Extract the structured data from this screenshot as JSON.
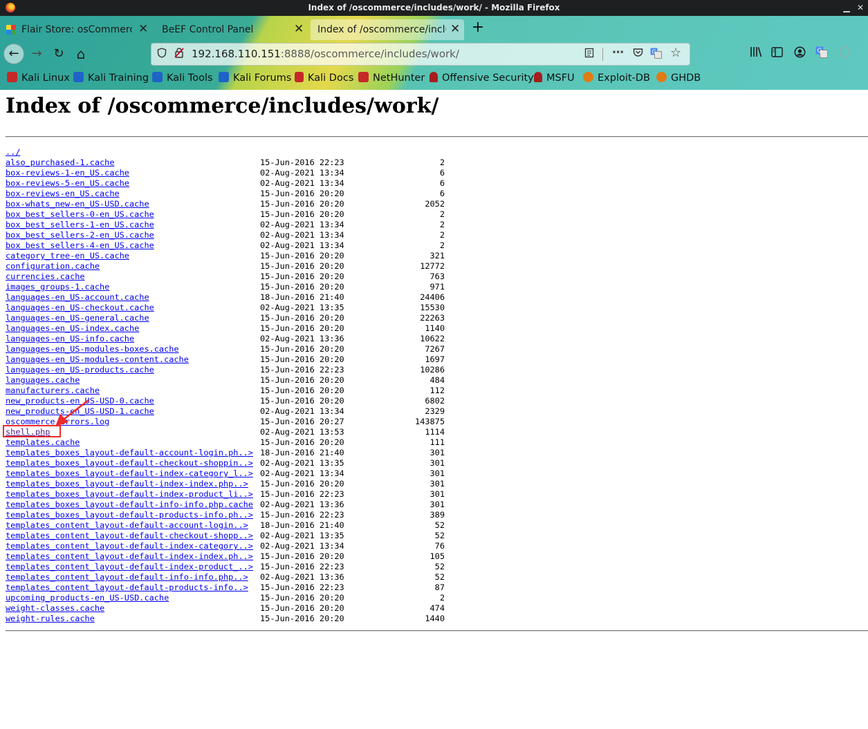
{
  "window": {
    "title": "Index of /oscommerce/includes/work/ - Mozilla Firefox",
    "minimize": "▁",
    "maximize": "☐",
    "close": "✕"
  },
  "tabs": [
    {
      "label": "Flair Store: osCommerce",
      "close": "✕"
    },
    {
      "label": "BeEF Control Panel",
      "close": "✕"
    },
    {
      "label": "Index of /oscommerce/includes/work/",
      "close": "✕"
    }
  ],
  "new_tab": "+",
  "nav": {
    "back": "←",
    "forward": "→",
    "reload": "↻",
    "home": "⌂"
  },
  "url": {
    "host": "192.168.110.151",
    "rest": ":8888/oscommerce/includes/work/"
  },
  "url_icons": [
    "shield-icon",
    "insecure-lock-icon",
    "reader-view-icon",
    "more-actions-icon",
    "pocket-icon",
    "translate-icon",
    "bookmark-star-icon"
  ],
  "toolbar_icons": [
    "library-icon",
    "sidebar-icon",
    "account-icon",
    "translate-icon",
    "extension-icon"
  ],
  "bookmarks": [
    {
      "label": "Kali Linux",
      "color": "#c62828"
    },
    {
      "label": "Kali Training",
      "color": "#1e63c7"
    },
    {
      "label": "Kali Tools",
      "color": "#1e63c7"
    },
    {
      "label": "Kali Forums",
      "color": "#1e63c7"
    },
    {
      "label": "Kali Docs",
      "color": "#c62828"
    },
    {
      "label": "NetHunter",
      "color": "#c62828"
    },
    {
      "label": "Offensive Security",
      "color": "#a51d1d"
    },
    {
      "label": "MSFU",
      "color": "#a51d1d"
    },
    {
      "label": "Exploit-DB",
      "color": "#e07b16"
    },
    {
      "label": "GHDB",
      "color": "#e07b16"
    }
  ],
  "page": {
    "title": "Index of /oscommerce/includes/work/",
    "parent_link": "../",
    "files": [
      {
        "name": "also_purchased-1.cache",
        "date": "15-Jun-2016 22:23",
        "size": "2"
      },
      {
        "name": "box-reviews-1-en_US.cache",
        "date": "02-Aug-2021 13:34",
        "size": "6"
      },
      {
        "name": "box-reviews-5-en_US.cache",
        "date": "02-Aug-2021 13:34",
        "size": "6"
      },
      {
        "name": "box-reviews-en_US.cache",
        "date": "15-Jun-2016 20:20",
        "size": "6"
      },
      {
        "name": "box-whats_new-en_US-USD.cache",
        "date": "15-Jun-2016 20:20",
        "size": "2052"
      },
      {
        "name": "box_best_sellers-0-en_US.cache",
        "date": "15-Jun-2016 20:20",
        "size": "2"
      },
      {
        "name": "box_best_sellers-1-en_US.cache",
        "date": "02-Aug-2021 13:34",
        "size": "2"
      },
      {
        "name": "box_best_sellers-2-en_US.cache",
        "date": "02-Aug-2021 13:34",
        "size": "2"
      },
      {
        "name": "box_best_sellers-4-en_US.cache",
        "date": "02-Aug-2021 13:34",
        "size": "2"
      },
      {
        "name": "category_tree-en_US.cache",
        "date": "15-Jun-2016 20:20",
        "size": "321"
      },
      {
        "name": "configuration.cache",
        "date": "15-Jun-2016 20:20",
        "size": "12772"
      },
      {
        "name": "currencies.cache",
        "date": "15-Jun-2016 20:20",
        "size": "763"
      },
      {
        "name": "images_groups-1.cache",
        "date": "15-Jun-2016 20:20",
        "size": "971"
      },
      {
        "name": "languages-en_US-account.cache",
        "date": "18-Jun-2016 21:40",
        "size": "24406"
      },
      {
        "name": "languages-en_US-checkout.cache",
        "date": "02-Aug-2021 13:35",
        "size": "15530"
      },
      {
        "name": "languages-en_US-general.cache",
        "date": "15-Jun-2016 20:20",
        "size": "22263"
      },
      {
        "name": "languages-en_US-index.cache",
        "date": "15-Jun-2016 20:20",
        "size": "1140"
      },
      {
        "name": "languages-en_US-info.cache",
        "date": "02-Aug-2021 13:36",
        "size": "10622"
      },
      {
        "name": "languages-en_US-modules-boxes.cache",
        "date": "15-Jun-2016 20:20",
        "size": "7267"
      },
      {
        "name": "languages-en_US-modules-content.cache",
        "date": "15-Jun-2016 20:20",
        "size": "1697"
      },
      {
        "name": "languages-en_US-products.cache",
        "date": "15-Jun-2016 22:23",
        "size": "10286"
      },
      {
        "name": "languages.cache",
        "date": "15-Jun-2016 20:20",
        "size": "484"
      },
      {
        "name": "manufacturers.cache",
        "date": "15-Jun-2016 20:20",
        "size": "112"
      },
      {
        "name": "new_products-en_US-USD-0.cache",
        "date": "15-Jun-2016 20:20",
        "size": "6802"
      },
      {
        "name": "new_products-en_US-USD-1.cache",
        "date": "02-Aug-2021 13:34",
        "size": "2329"
      },
      {
        "name": "oscommerce_errors.log",
        "date": "15-Jun-2016 20:27",
        "size": "143875"
      },
      {
        "name": "shell.php",
        "date": "02-Aug-2021 13:53",
        "size": "1114",
        "visited": true
      },
      {
        "name": "templates.cache",
        "date": "15-Jun-2016 20:20",
        "size": "111"
      },
      {
        "name": "templates_boxes_layout-default-account-login.ph..>",
        "date": "18-Jun-2016 21:40",
        "size": "301"
      },
      {
        "name": "templates_boxes_layout-default-checkout-shoppin..>",
        "date": "02-Aug-2021 13:35",
        "size": "301"
      },
      {
        "name": "templates_boxes_layout-default-index-category_l..>",
        "date": "02-Aug-2021 13:34",
        "size": "301"
      },
      {
        "name": "templates_boxes_layout-default-index-index.php..>",
        "date": "15-Jun-2016 20:20",
        "size": "301"
      },
      {
        "name": "templates_boxes_layout-default-index-product_li..>",
        "date": "15-Jun-2016 22:23",
        "size": "301"
      },
      {
        "name": "templates_boxes_layout-default-info-info.php.cache",
        "date": "02-Aug-2021 13:36",
        "size": "301"
      },
      {
        "name": "templates_boxes_layout-default-products-info.ph..>",
        "date": "15-Jun-2016 22:23",
        "size": "389"
      },
      {
        "name": "templates_content_layout-default-account-login..>",
        "date": "18-Jun-2016 21:40",
        "size": "52"
      },
      {
        "name": "templates_content_layout-default-checkout-shopp..>",
        "date": "02-Aug-2021 13:35",
        "size": "52"
      },
      {
        "name": "templates_content_layout-default-index-category..>",
        "date": "02-Aug-2021 13:34",
        "size": "76"
      },
      {
        "name": "templates_content_layout-default-index-index.ph..>",
        "date": "15-Jun-2016 20:20",
        "size": "105"
      },
      {
        "name": "templates_content_layout-default-index-product_..>",
        "date": "15-Jun-2016 22:23",
        "size": "52"
      },
      {
        "name": "templates_content_layout-default-info-info.php..>",
        "date": "02-Aug-2021 13:36",
        "size": "52"
      },
      {
        "name": "templates_content_layout-default-products-info..>",
        "date": "15-Jun-2016 22:23",
        "size": "87"
      },
      {
        "name": "upcoming_products-en_US-USD.cache",
        "date": "15-Jun-2016 20:20",
        "size": "2"
      },
      {
        "name": "weight-classes.cache",
        "date": "15-Jun-2016 20:20",
        "size": "474"
      },
      {
        "name": "weight-rules.cache",
        "date": "15-Jun-2016 20:20",
        "size": "1440"
      }
    ]
  },
  "annotation": {
    "color": "#ee2b2b",
    "target": "shell.php"
  }
}
